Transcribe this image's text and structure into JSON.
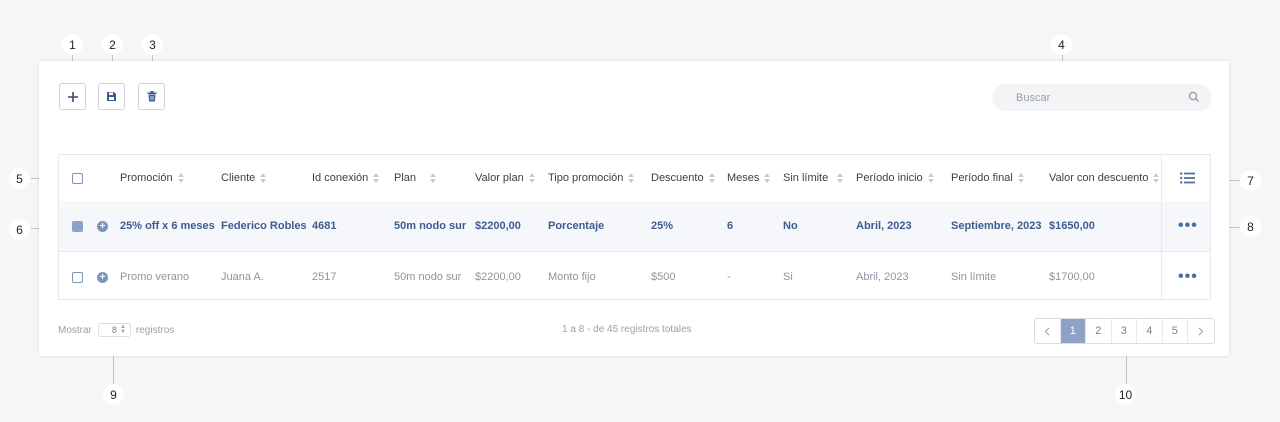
{
  "toolbar": {
    "add_icon": "plus-icon",
    "save_icon": "floppy-disk-icon",
    "delete_icon": "trash-icon"
  },
  "search": {
    "placeholder": "Buscar",
    "icon": "search-icon"
  },
  "table": {
    "columns": [
      "Promoción",
      "Cliente",
      "Id conexión",
      "Plan",
      "Valor plan",
      "Tipo promoción",
      "Descuento",
      "Meses",
      "Sin límite",
      "Período inicio",
      "Período final",
      "Valor con descuento"
    ],
    "column_menu_icon": "list-icon",
    "rows": [
      {
        "selected": true,
        "cells": [
          "25% off x 6 meses",
          "Federico Robles",
          "4681",
          "50m nodo sur",
          "$2200,00",
          "Porcentaje",
          "25%",
          "6",
          "No",
          "Abril, 2023",
          "Septiembre, 2023",
          "$1650,00"
        ]
      },
      {
        "selected": false,
        "cells": [
          "Promo verano",
          "Juana A.",
          "2517",
          "50m nodo sur",
          "$2200,00",
          "Monto fijo",
          "$500",
          "-",
          "Si",
          "Abril, 2023",
          "Sin límite",
          "$1700,00"
        ]
      }
    ],
    "row_actions_icon": "more-horizontal-icon"
  },
  "footer": {
    "show_label": "Mostrar",
    "page_size": "8",
    "records_label": "registros",
    "summary": "1 a 8 - de 45 registros totales",
    "pages": [
      "1",
      "2",
      "3",
      "4",
      "5"
    ],
    "current_page": "1",
    "prev_icon": "chevron-left-icon",
    "next_icon": "chevron-right-icon"
  },
  "callouts": [
    "1",
    "2",
    "3",
    "4",
    "5",
    "6",
    "7",
    "8",
    "9",
    "10"
  ],
  "colors": {
    "accent": "#8da2c6",
    "selected_text": "#3d5c8f",
    "background": "#f6f6f6"
  }
}
